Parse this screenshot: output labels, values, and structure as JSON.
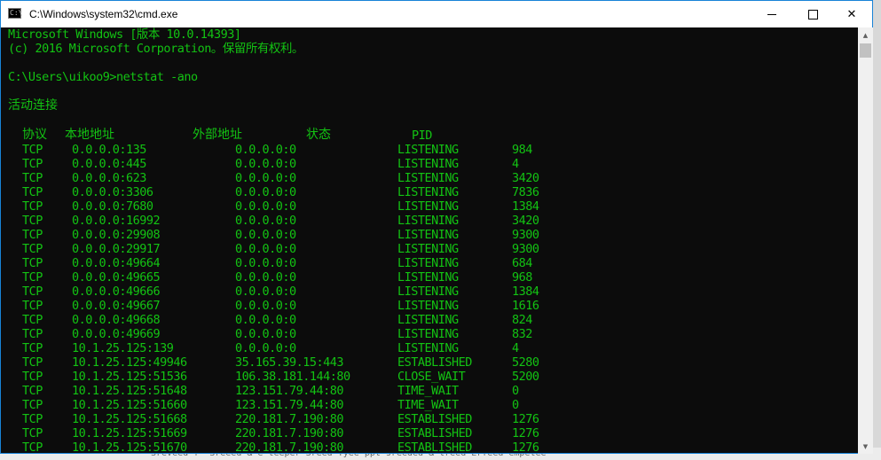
{
  "window": {
    "title": "C:\\Windows\\system32\\cmd.exe",
    "controls": {
      "minimize": "minimize",
      "maximize": "maximize",
      "close": "close"
    },
    "icon": "cmd-icon"
  },
  "background": {
    "bottom_text": "Sreveed-f- Sreeed & e-teeper Sreed Tyee-ppt-sreeded-&-treed Erfeed-empetee"
  },
  "console": {
    "lines": [
      "Microsoft Windows [版本 10.0.14393]",
      "(c) 2016 Microsoft Corporation。保留所有权利。",
      "",
      "C:\\Users\\uikoo9>netstat -ano",
      "",
      "活动连接"
    ],
    "table": {
      "headers": [
        "协议",
        "本地地址",
        "外部地址",
        "状态",
        "PID"
      ],
      "rows": [
        [
          "TCP",
          "0.0.0.0:135",
          "0.0.0.0:0",
          "LISTENING",
          "984"
        ],
        [
          "TCP",
          "0.0.0.0:445",
          "0.0.0.0:0",
          "LISTENING",
          "4"
        ],
        [
          "TCP",
          "0.0.0.0:623",
          "0.0.0.0:0",
          "LISTENING",
          "3420"
        ],
        [
          "TCP",
          "0.0.0.0:3306",
          "0.0.0.0:0",
          "LISTENING",
          "7836"
        ],
        [
          "TCP",
          "0.0.0.0:7680",
          "0.0.0.0:0",
          "LISTENING",
          "1384"
        ],
        [
          "TCP",
          "0.0.0.0:16992",
          "0.0.0.0:0",
          "LISTENING",
          "3420"
        ],
        [
          "TCP",
          "0.0.0.0:29908",
          "0.0.0.0:0",
          "LISTENING",
          "9300"
        ],
        [
          "TCP",
          "0.0.0.0:29917",
          "0.0.0.0:0",
          "LISTENING",
          "9300"
        ],
        [
          "TCP",
          "0.0.0.0:49664",
          "0.0.0.0:0",
          "LISTENING",
          "684"
        ],
        [
          "TCP",
          "0.0.0.0:49665",
          "0.0.0.0:0",
          "LISTENING",
          "968"
        ],
        [
          "TCP",
          "0.0.0.0:49666",
          "0.0.0.0:0",
          "LISTENING",
          "1384"
        ],
        [
          "TCP",
          "0.0.0.0:49667",
          "0.0.0.0:0",
          "LISTENING",
          "1616"
        ],
        [
          "TCP",
          "0.0.0.0:49668",
          "0.0.0.0:0",
          "LISTENING",
          "824"
        ],
        [
          "TCP",
          "0.0.0.0:49669",
          "0.0.0.0:0",
          "LISTENING",
          "832"
        ],
        [
          "TCP",
          "10.1.25.125:139",
          "0.0.0.0:0",
          "LISTENING",
          "4"
        ],
        [
          "TCP",
          "10.1.25.125:49946",
          "35.165.39.15:443",
          "ESTABLISHED",
          "5280"
        ],
        [
          "TCP",
          "10.1.25.125:51536",
          "106.38.181.144:80",
          "CLOSE_WAIT",
          "5200"
        ],
        [
          "TCP",
          "10.1.25.125:51648",
          "123.151.79.44:80",
          "TIME_WAIT",
          "0"
        ],
        [
          "TCP",
          "10.1.25.125:51660",
          "123.151.79.44:80",
          "TIME_WAIT",
          "0"
        ],
        [
          "TCP",
          "10.1.25.125:51668",
          "220.181.7.190:80",
          "ESTABLISHED",
          "1276"
        ],
        [
          "TCP",
          "10.1.25.125:51669",
          "220.181.7.190:80",
          "ESTABLISHED",
          "1276"
        ],
        [
          "TCP",
          "10.1.25.125:51670",
          "220.181.7.190:80",
          "ESTABLISHED",
          "1276"
        ]
      ]
    }
  },
  "colors": {
    "console_text": "#13c313",
    "console_bg": "#0c0c0c",
    "window_border": "#1883d7"
  }
}
